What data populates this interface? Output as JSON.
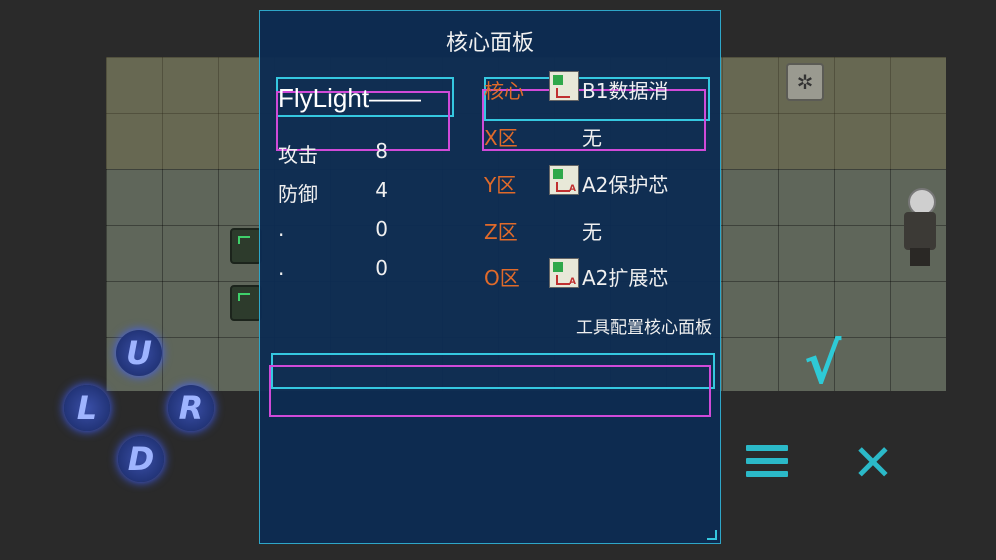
{
  "panel": {
    "title": "核心面板",
    "character_name": "FlyLight——",
    "stats": [
      {
        "label": "攻击",
        "value": "8"
      },
      {
        "label": "防御",
        "value": "4"
      },
      {
        "label": ".",
        "value": "0"
      },
      {
        "label": ".",
        "value": "0"
      }
    ],
    "slots": [
      {
        "label": "核心",
        "value": "B1数据消",
        "icon": "chip-icon"
      },
      {
        "label": "X区",
        "value": "无",
        "icon": ""
      },
      {
        "label": "Y区",
        "value": "A2保护芯",
        "icon": "chip-icon"
      },
      {
        "label": "Z区",
        "value": "无",
        "icon": ""
      },
      {
        "label": "O区",
        "value": "A2扩展芯",
        "icon": "chip-icon"
      }
    ],
    "config_label": "工具配置核心面板"
  },
  "controls": {
    "dpad": {
      "up": "U",
      "left": "L",
      "right": "R",
      "down": "D"
    },
    "confirm": "√",
    "close": "✕",
    "menu_icon": "hamburger-icon"
  },
  "colors": {
    "accent_cyan": "#35c8e0",
    "accent_pink": "#d04ad8",
    "slot_label": "#e06a2a",
    "panel_bg": "#0c2c52"
  }
}
